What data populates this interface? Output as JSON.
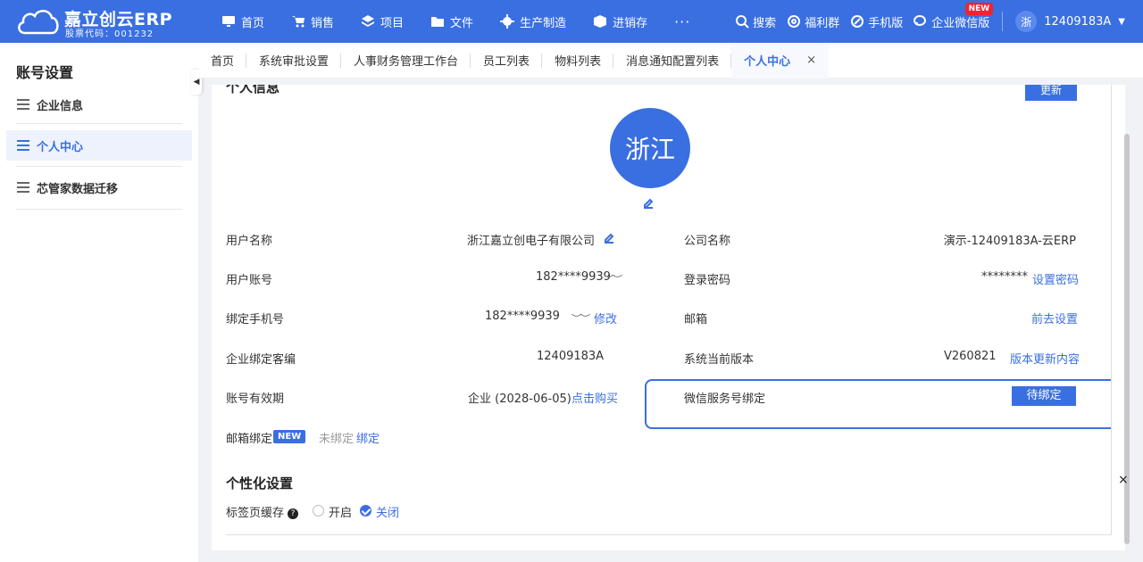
{
  "brand": {
    "title": "嘉立创云ERP",
    "subtitle": "股票代码：001232",
    "cloud_text": "ERP"
  },
  "nav": [
    {
      "label": "首页",
      "icon": "monitor-icon"
    },
    {
      "label": "销售",
      "icon": "cart-icon"
    },
    {
      "label": "项目",
      "icon": "layers-icon"
    },
    {
      "label": "文件",
      "icon": "folder-icon"
    },
    {
      "label": "生产制造",
      "icon": "gear-icon"
    },
    {
      "label": "进销存",
      "icon": "box-icon"
    }
  ],
  "nav_more": "···",
  "right_nav": {
    "search": "搜索",
    "welfare": "福利群",
    "mobile": "手机版",
    "wechat": "企业微信版",
    "new_badge": "NEW",
    "avatar": "浙",
    "user_id": "12409183A"
  },
  "sidebar": {
    "title": "账号设置",
    "items": [
      {
        "label": "企业信息"
      },
      {
        "label": "个人中心"
      },
      {
        "label": "芯管家数据迁移"
      }
    ]
  },
  "tabs": [
    {
      "label": "首页"
    },
    {
      "label": "系统审批设置"
    },
    {
      "label": "人事财务管理工作台"
    },
    {
      "label": "员工列表"
    },
    {
      "label": "物料列表"
    },
    {
      "label": "消息通知配置列表"
    },
    {
      "label": "个人中心"
    }
  ],
  "tab_close": "×",
  "profile": {
    "section_title": "个人信息",
    "update_label": "更新",
    "avatar_text": "浙江",
    "user_name_label": "用户名称",
    "user_name_value": "浙江嘉立创电子有限公司",
    "company_label": "公司名称",
    "company_value": "演示-12409183A-云ERP",
    "account_label": "用户账号",
    "account_value": "182****9939",
    "password_label": "登录密码",
    "password_value": "********",
    "password_link": "设置密码",
    "phone_label": "绑定手机号",
    "phone_value": "182****9939",
    "phone_link": "修改",
    "email_label": "邮箱",
    "email_link": "前去设置",
    "customer_label": "企业绑定客编",
    "customer_value": "12409183A",
    "version_label": "系统当前版本",
    "version_value": "V260821",
    "version_link": "版本更新内容",
    "expiry_label": "账号有效期",
    "expiry_value": "企业 (2028-06-05)",
    "expiry_link": "点击购买",
    "wechat_label": "微信服务号绑定",
    "wechat_button": "待绑定",
    "mailbox_label": "邮箱绑定",
    "mailbox_tag": "NEW",
    "mailbox_status": "未绑定",
    "mailbox_link": "绑定",
    "eye_glyph": "︶︶"
  },
  "personalize": {
    "title": "个性化设置",
    "tab_cache_label": "标签页缓存",
    "help": "?",
    "option_on": "开启",
    "option_off": "关闭",
    "selected": "关闭"
  },
  "close_glyph": "×",
  "colors": {
    "primary": "#3a6fe1",
    "badge": "#f5222d"
  }
}
